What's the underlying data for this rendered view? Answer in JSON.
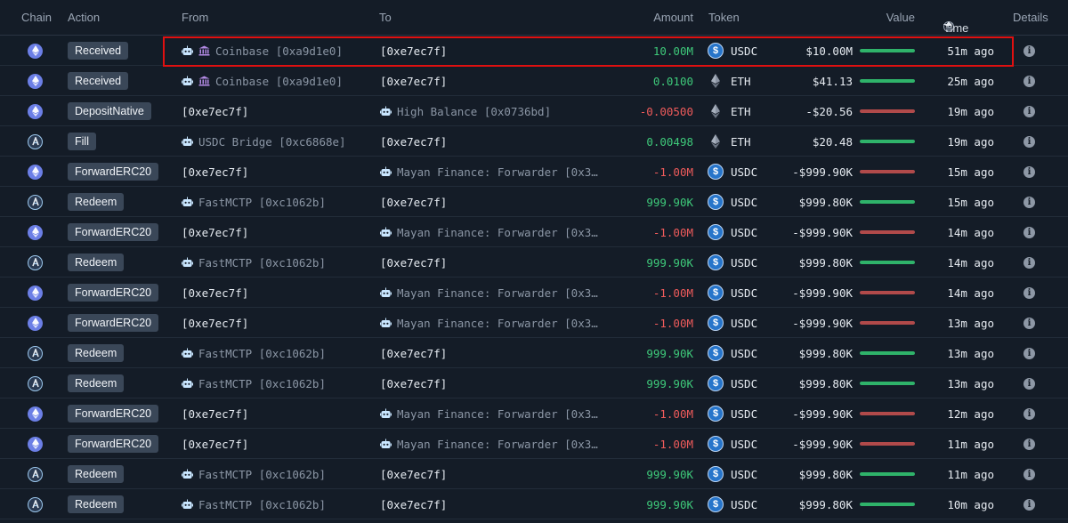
{
  "header": {
    "chain": "Chain",
    "action": "Action",
    "from": "From",
    "to": "To",
    "amount": "Amount",
    "token": "Token",
    "value": "Value",
    "time": "Time",
    "details": "Details"
  },
  "colors": {
    "positive": "#3ec97a",
    "negative": "#ef5b5b",
    "highlight": "#e01010"
  },
  "rows": [
    {
      "chain": "ethereum",
      "action": "Received",
      "from": {
        "type": "entity",
        "icons": [
          "robot-icon",
          "bank-icon"
        ],
        "text": "Coinbase [0xa9d1e0]"
      },
      "to": {
        "type": "address",
        "text": "[0xe7ec7f]"
      },
      "amount": "10.00M",
      "sign": "pos",
      "token": "USDC",
      "value": "$10.00M",
      "bar": 1.0,
      "time": "51m ago",
      "highlighted": true
    },
    {
      "chain": "ethereum",
      "action": "Received",
      "from": {
        "type": "entity",
        "icons": [
          "robot-icon",
          "bank-icon"
        ],
        "text": "Coinbase [0xa9d1e0]"
      },
      "to": {
        "type": "address",
        "text": "[0xe7ec7f]"
      },
      "amount": "0.0100",
      "sign": "pos",
      "token": "ETH",
      "value": "$41.13",
      "bar": 1.0,
      "time": "25m ago"
    },
    {
      "chain": "ethereum",
      "action": "DepositNative",
      "from": {
        "type": "address",
        "text": "[0xe7ec7f]"
      },
      "to": {
        "type": "entity",
        "icons": [
          "robot-icon"
        ],
        "text": "High Balance [0x0736bd]"
      },
      "amount": "-0.00500",
      "sign": "neg",
      "token": "ETH",
      "value": "-$20.56",
      "bar": 1.0,
      "time": "19m ago"
    },
    {
      "chain": "arbitrum",
      "action": "Fill",
      "from": {
        "type": "entity",
        "icons": [
          "robot-icon"
        ],
        "text": "USDC Bridge [0xc6868e]"
      },
      "to": {
        "type": "address",
        "text": "[0xe7ec7f]"
      },
      "amount": "0.00498",
      "sign": "pos",
      "token": "ETH",
      "value": "$20.48",
      "bar": 1.0,
      "time": "19m ago"
    },
    {
      "chain": "ethereum",
      "action": "ForwardERC20",
      "from": {
        "type": "address",
        "text": "[0xe7ec7f]"
      },
      "to": {
        "type": "entity",
        "icons": [
          "robot-icon"
        ],
        "text": "Mayan Finance: Forwarder [0x3…"
      },
      "amount": "-1.00M",
      "sign": "neg",
      "token": "USDC",
      "value": "-$999.90K",
      "bar": 1.0,
      "time": "15m ago"
    },
    {
      "chain": "arbitrum",
      "action": "Redeem",
      "from": {
        "type": "entity",
        "icons": [
          "robot-icon"
        ],
        "text": "FastMCTP [0xc1062b]"
      },
      "to": {
        "type": "address",
        "text": "[0xe7ec7f]"
      },
      "amount": "999.90K",
      "sign": "pos",
      "token": "USDC",
      "value": "$999.80K",
      "bar": 1.0,
      "time": "15m ago"
    },
    {
      "chain": "ethereum",
      "action": "ForwardERC20",
      "from": {
        "type": "address",
        "text": "[0xe7ec7f]"
      },
      "to": {
        "type": "entity",
        "icons": [
          "robot-icon"
        ],
        "text": "Mayan Finance: Forwarder [0x3…"
      },
      "amount": "-1.00M",
      "sign": "neg",
      "token": "USDC",
      "value": "-$999.90K",
      "bar": 1.0,
      "time": "14m ago"
    },
    {
      "chain": "arbitrum",
      "action": "Redeem",
      "from": {
        "type": "entity",
        "icons": [
          "robot-icon"
        ],
        "text": "FastMCTP [0xc1062b]"
      },
      "to": {
        "type": "address",
        "text": "[0xe7ec7f]"
      },
      "amount": "999.90K",
      "sign": "pos",
      "token": "USDC",
      "value": "$999.80K",
      "bar": 1.0,
      "time": "14m ago"
    },
    {
      "chain": "ethereum",
      "action": "ForwardERC20",
      "from": {
        "type": "address",
        "text": "[0xe7ec7f]"
      },
      "to": {
        "type": "entity",
        "icons": [
          "robot-icon"
        ],
        "text": "Mayan Finance: Forwarder [0x3…"
      },
      "amount": "-1.00M",
      "sign": "neg",
      "token": "USDC",
      "value": "-$999.90K",
      "bar": 1.0,
      "time": "14m ago"
    },
    {
      "chain": "ethereum",
      "action": "ForwardERC20",
      "from": {
        "type": "address",
        "text": "[0xe7ec7f]"
      },
      "to": {
        "type": "entity",
        "icons": [
          "robot-icon"
        ],
        "text": "Mayan Finance: Forwarder [0x3…"
      },
      "amount": "-1.00M",
      "sign": "neg",
      "token": "USDC",
      "value": "-$999.90K",
      "bar": 1.0,
      "time": "13m ago"
    },
    {
      "chain": "arbitrum",
      "action": "Redeem",
      "from": {
        "type": "entity",
        "icons": [
          "robot-icon"
        ],
        "text": "FastMCTP [0xc1062b]"
      },
      "to": {
        "type": "address",
        "text": "[0xe7ec7f]"
      },
      "amount": "999.90K",
      "sign": "pos",
      "token": "USDC",
      "value": "$999.80K",
      "bar": 1.0,
      "time": "13m ago"
    },
    {
      "chain": "arbitrum",
      "action": "Redeem",
      "from": {
        "type": "entity",
        "icons": [
          "robot-icon"
        ],
        "text": "FastMCTP [0xc1062b]"
      },
      "to": {
        "type": "address",
        "text": "[0xe7ec7f]"
      },
      "amount": "999.90K",
      "sign": "pos",
      "token": "USDC",
      "value": "$999.80K",
      "bar": 1.0,
      "time": "13m ago"
    },
    {
      "chain": "ethereum",
      "action": "ForwardERC20",
      "from": {
        "type": "address",
        "text": "[0xe7ec7f]"
      },
      "to": {
        "type": "entity",
        "icons": [
          "robot-icon"
        ],
        "text": "Mayan Finance: Forwarder [0x3…"
      },
      "amount": "-1.00M",
      "sign": "neg",
      "token": "USDC",
      "value": "-$999.90K",
      "bar": 1.0,
      "time": "12m ago"
    },
    {
      "chain": "ethereum",
      "action": "ForwardERC20",
      "from": {
        "type": "address",
        "text": "[0xe7ec7f]"
      },
      "to": {
        "type": "entity",
        "icons": [
          "robot-icon"
        ],
        "text": "Mayan Finance: Forwarder [0x3…"
      },
      "amount": "-1.00M",
      "sign": "neg",
      "token": "USDC",
      "value": "-$999.90K",
      "bar": 1.0,
      "time": "11m ago"
    },
    {
      "chain": "arbitrum",
      "action": "Redeem",
      "from": {
        "type": "entity",
        "icons": [
          "robot-icon"
        ],
        "text": "FastMCTP [0xc1062b]"
      },
      "to": {
        "type": "address",
        "text": "[0xe7ec7f]"
      },
      "amount": "999.90K",
      "sign": "pos",
      "token": "USDC",
      "value": "$999.80K",
      "bar": 1.0,
      "time": "11m ago"
    },
    {
      "chain": "arbitrum",
      "action": "Redeem",
      "from": {
        "type": "entity",
        "icons": [
          "robot-icon"
        ],
        "text": "FastMCTP [0xc1062b]"
      },
      "to": {
        "type": "address",
        "text": "[0xe7ec7f]"
      },
      "amount": "999.90K",
      "sign": "pos",
      "token": "USDC",
      "value": "$999.80K",
      "bar": 1.0,
      "time": "10m ago"
    }
  ]
}
